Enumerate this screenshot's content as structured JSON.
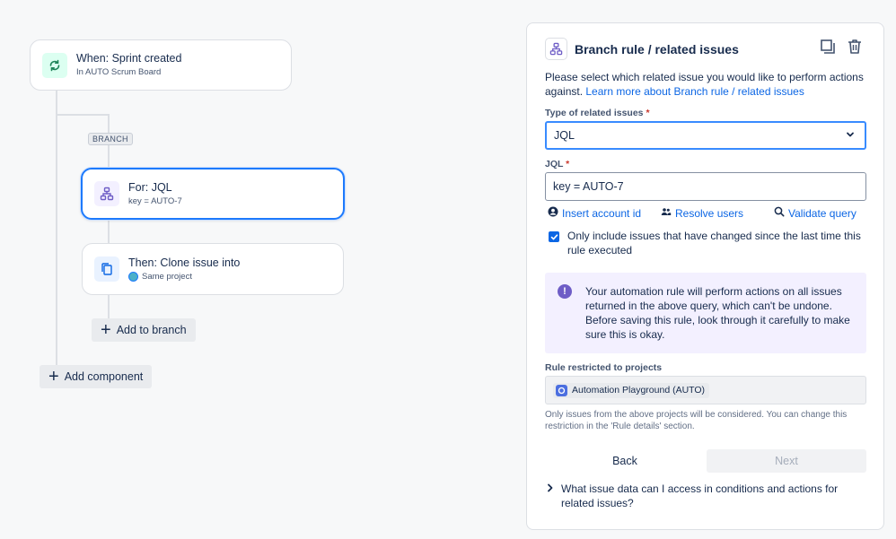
{
  "canvas": {
    "trigger": {
      "title": "When: Sprint created",
      "subtitle": "In AUTO Scrum Board"
    },
    "branch_tag": "BRANCH",
    "branch_card": {
      "title": "For: JQL",
      "subtitle": "key = AUTO-7"
    },
    "action_card": {
      "title": "Then: Clone issue into",
      "subtitle": "Same project"
    },
    "add_to_branch": "Add to branch",
    "add_component": "Add component"
  },
  "panel": {
    "title": "Branch rule / related issues",
    "description": "Please select which related issue you would like to perform actions against.",
    "learn_more": "Learn more about Branch rule / related issues",
    "type_label": "Type of related issues",
    "required_mark": "*",
    "type_value": "JQL",
    "jql_label": "JQL",
    "jql_value": "key = AUTO-7",
    "insert_account": "Insert account id",
    "resolve_users": "Resolve users",
    "validate_query": "Validate query",
    "checkbox_label": "Only include issues that have changed since the last time this rule executed",
    "checkbox_checked": true,
    "notice": "Your automation rule will perform actions on all issues returned in the above query, which can't be undone. Before saving this rule, look through it carefully to make sure this is okay.",
    "restricted_label": "Rule restricted to projects",
    "project_chip": "Automation Playground (AUTO)",
    "help_text": "Only issues from the above projects will be considered. You can change this restriction in the 'Rule details' section.",
    "back": "Back",
    "next": "Next",
    "faq": "What issue data can I access in conditions and actions for related issues?"
  },
  "colors": {
    "accent": "#1d7afc",
    "link": "#0c66e4",
    "notice_bg": "#f3f0ff",
    "trigger_icon_bg": "#dcfff1",
    "branch_icon_bg": "#f3f0ff",
    "action_icon_bg": "#e9f2ff"
  },
  "icons": [
    "refresh-icon",
    "hierarchy-icon",
    "copy-icon",
    "duplicate-icon",
    "trash-icon",
    "chevron-down-icon",
    "user-circle-icon",
    "people-icon",
    "search-icon",
    "check-icon",
    "info-icon",
    "project-icon",
    "chevron-right-icon",
    "plus-icon"
  ]
}
